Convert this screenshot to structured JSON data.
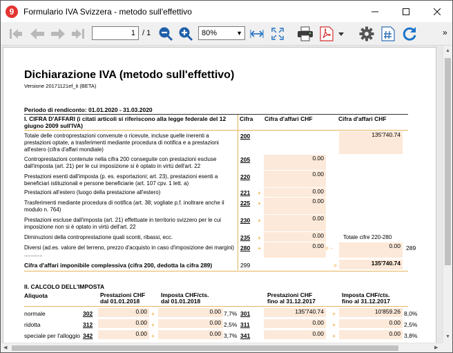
{
  "window": {
    "title": "Formulario IVA Svizzera - metodo sull'effettivo",
    "app_icon": "9"
  },
  "toolbar": {
    "page_current": "1",
    "page_total": "/ 1",
    "zoom": "80%",
    "more": "»"
  },
  "doc": {
    "title": "Dichiarazione IVA (metodo sull'effettivo)",
    "version": "Versione 20171121ef_it (BETA)",
    "period": "Periodo di rendiconto: 01.01.2020 - 31.03.2020",
    "s1": {
      "heading": "I. CIFRA D'AFFARI (i citati articoli si riferiscono alla legge federale del 12 giugno 2009 sull'IVA)",
      "col_cifra": "Cifra",
      "col_ca1": "Cifra d'affari CHF",
      "col_ca2": "Cifra d'affari CHF",
      "rows": [
        {
          "text": "Totale delle controprestazioni convenute o ricevute, incluse quelle inerenti a prestazioni optate, a trasferimenti mediante procedura di notifica e a prestazioni all'estero (cifra d'affari mondiale)",
          "code": "200",
          "v2": "135'740.74"
        },
        {
          "text": "Controprestazioni contenute nella cifra 200 conseguite con prestazioni escluse dall'imposta (art. 21) per le cui imposizione si è optato in virtù dell'art. 22",
          "code": "205",
          "v1": "0.00"
        },
        {
          "text": "Prestazioni esenti dall'imposta (p. es. esportazioni; art. 23), prestazioni esenti a beneficiari istituzionali e persone beneficiarie (art. 107 cpv. 1 lett. a)",
          "code": "220",
          "v1": "0.00"
        },
        {
          "text": "Prestazioni all'estero (luogo della prestazione all'estero)",
          "code": "221",
          "v1": "0.00",
          "op": "+"
        },
        {
          "text": "Trasferimenti mediante procedura di notifica (art. 38; vogliate p.f. inoltrare anche il modulo n. 764)",
          "code": "225",
          "v1": "0.00",
          "op": "+"
        },
        {
          "text": "Prestazioni escluse dall'imposta (art. 21) effettuate in territorio svizzero per le cui imposizione non si è optato in virtù dell'art. 22",
          "code": "230",
          "v1": "0.00",
          "op": "+"
        },
        {
          "text": "Diminuzioni della controprestazione quali sconti, ribassi, ecc.",
          "code": "235",
          "v1": "0.00",
          "op": "+",
          "note": "Totale cifre 220-280"
        },
        {
          "text": "Diversi (ad.es. valore del terreno, prezzo d'acquisto in caso d'imposizione dei margini) ............",
          "code": "280",
          "v1": "0.00",
          "op": "+",
          "op2": "= -",
          "v2": "0.00",
          "ref": "289"
        }
      ],
      "total_label": "Cifra d'affari imponibile complessiva (cifra 200, dedotta la cifra 289)",
      "total_code": "299",
      "total_op": "=",
      "total_value": "135'740.74"
    },
    "s2": {
      "heading": "II. CALCOLO DELL'IMPOSTA",
      "col_aliquota": "Aliquota",
      "col_p1": "Prestazioni CHF",
      "col_p1b": "dal 01.01.2018",
      "col_i1": "Imposta CHF/cts.",
      "col_i1b": "dal 01.01.2018",
      "col_p2": "Prestazioni CHF",
      "col_p2b": "fino al 31.12.2017",
      "col_i2": "Imposta CHF/cts.",
      "col_i2b": "fino al 31.12.2017",
      "rows": [
        {
          "label": "normale",
          "c1": "302",
          "p1": "0.00",
          "i1": "0.00",
          "r1": "7,7%",
          "c2": "301",
          "p2": "135'740.74",
          "i2": "10'859.26",
          "r2": "8,0%"
        },
        {
          "label": "ridotta",
          "c1": "312",
          "p1": "0.00",
          "i1": "0.00",
          "r1": "2,5%",
          "c2": "311",
          "p2": "0.00",
          "i2": "0.00",
          "r2": "2,5%"
        },
        {
          "label": "speciale per l'alloggio",
          "c1": "342",
          "p1": "0.00",
          "i1": "0.00",
          "r1": "3,7%",
          "c2": "341",
          "p2": "0.00",
          "i2": "0.00",
          "r2": "3,8%"
        }
      ]
    }
  },
  "colors": {
    "accent": "#e3b35c",
    "cell": "#fde9d9",
    "nav_gray": "#b9b9b9",
    "zoom_blue": "#1f5fa8",
    "pdf_red": "#d32f2f",
    "refresh_blue": "#1a73c8"
  }
}
